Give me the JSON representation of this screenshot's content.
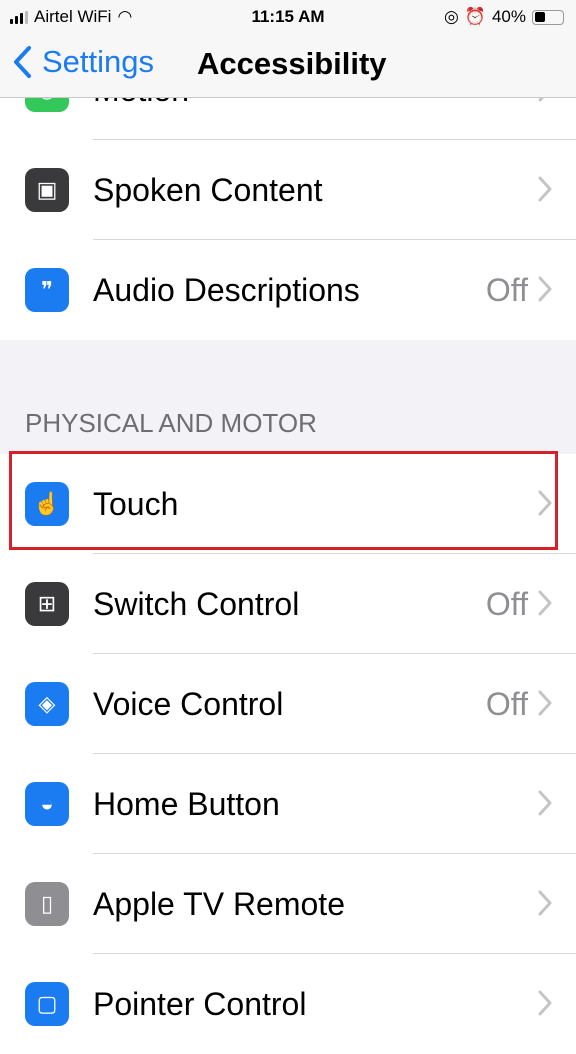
{
  "status_bar": {
    "carrier": "Airtel WiFi",
    "time": "11:15 AM",
    "battery": "40%",
    "battery_level": 0.4
  },
  "nav": {
    "back_label": "Settings",
    "title": "Accessibility"
  },
  "group1": [
    {
      "label": "Motion",
      "value": "",
      "icon": "motion-icon",
      "color": "#34c759"
    },
    {
      "label": "Spoken Content",
      "value": "",
      "icon": "speech-bubble-icon",
      "color": "#3a3a3c"
    },
    {
      "label": "Audio Descriptions",
      "value": "Off",
      "icon": "quote-bubble-icon",
      "color": "#1a7cf0"
    }
  ],
  "section_header": "PHYSICAL AND MOTOR",
  "group2": [
    {
      "label": "Touch",
      "value": "",
      "icon": "hand-pointer-icon",
      "color": "#1a7cf0"
    },
    {
      "label": "Switch Control",
      "value": "Off",
      "icon": "grid-icon",
      "color": "#3a3a3c"
    },
    {
      "label": "Voice Control",
      "value": "Off",
      "icon": "voice-control-icon",
      "color": "#1a7cf0"
    },
    {
      "label": "Home Button",
      "value": "",
      "icon": "home-button-icon",
      "color": "#1a7cf0"
    },
    {
      "label": "Apple TV Remote",
      "value": "",
      "icon": "remote-icon",
      "color": "#8e8e93"
    },
    {
      "label": "Pointer Control",
      "value": "",
      "icon": "pointer-icon",
      "color": "#1a7cf0"
    }
  ]
}
